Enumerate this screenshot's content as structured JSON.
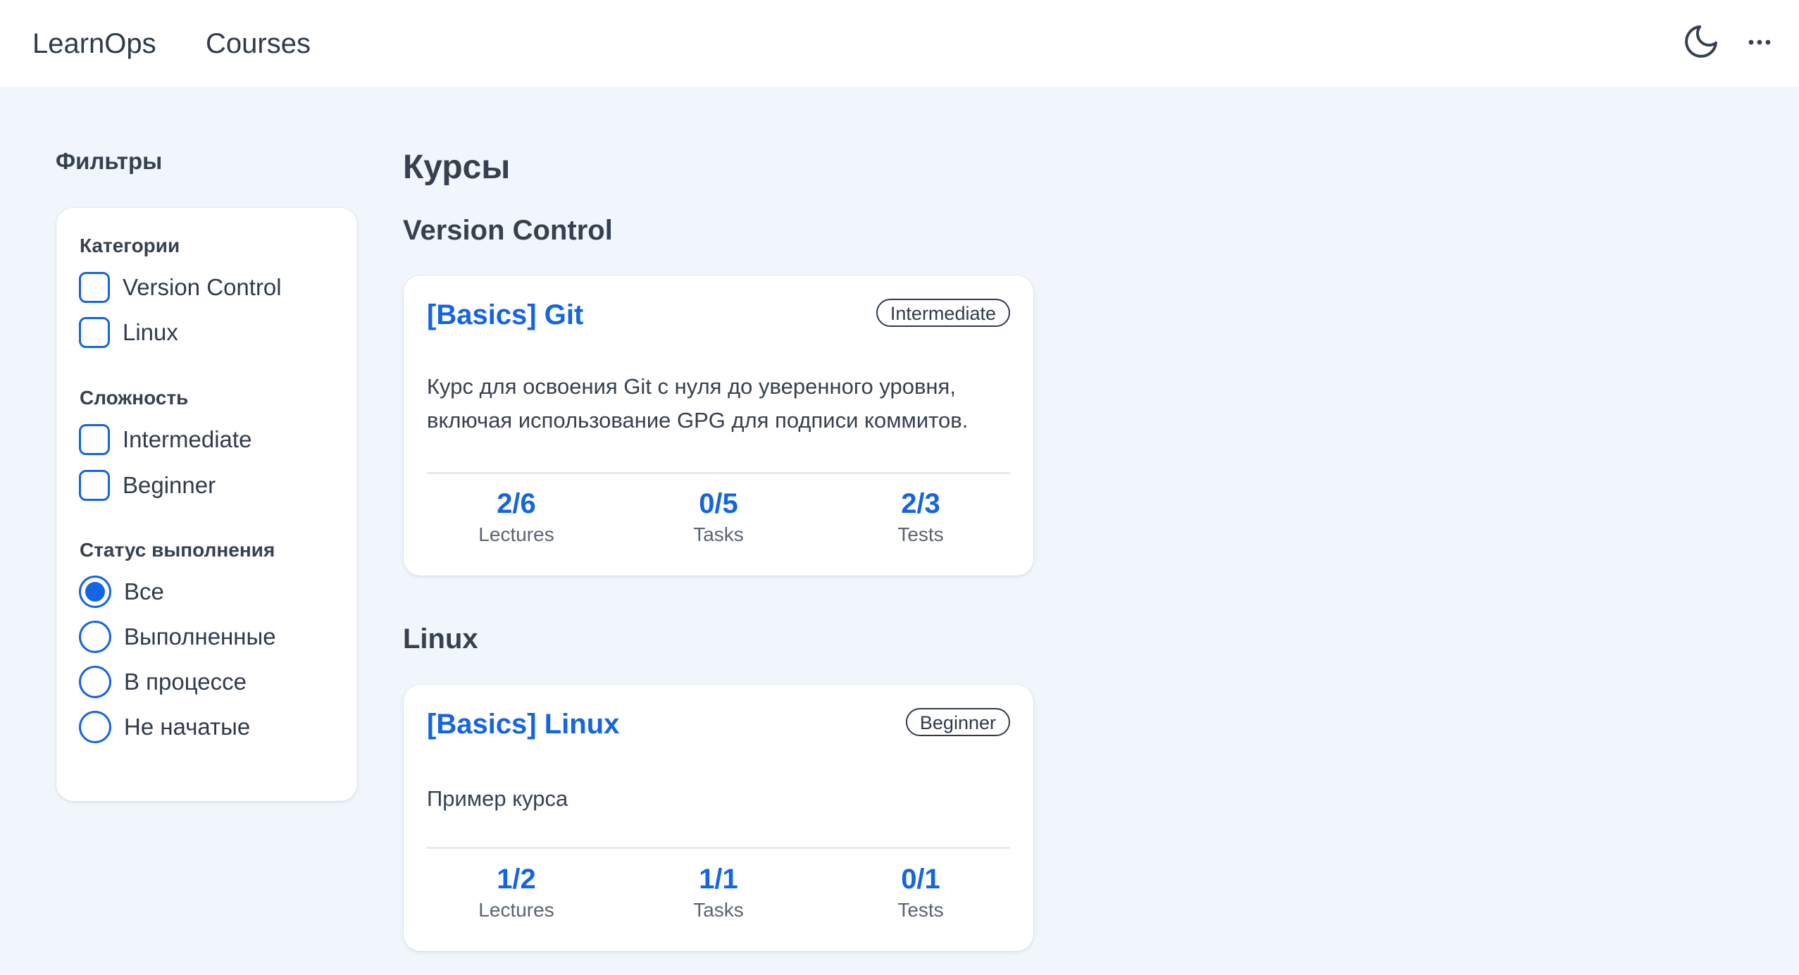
{
  "header": {
    "brand": "LearnOps",
    "nav_courses": "Courses",
    "theme_icon": "moon-icon",
    "more_icon": "more-dots-icon"
  },
  "filters": {
    "title": "Фильтры",
    "categories_label": "Категории",
    "categories": [
      "Version Control",
      "Linux"
    ],
    "difficulty_label": "Сложность",
    "difficulty": [
      "Intermediate",
      "Beginner"
    ],
    "status_label": "Статус выполнения",
    "status": [
      "Все",
      "Выполненные",
      "В процессе",
      "Не начатые"
    ],
    "status_selected": "Все"
  },
  "main": {
    "title": "Курсы",
    "sections": [
      {
        "name": "Version Control",
        "course": {
          "title": "[Basics] Git",
          "level": "Intermediate",
          "description": "Курс для освоения Git с нуля до уверенного уровня, включая использование GPG для подписи коммитов.",
          "stats": [
            {
              "value": "2/6",
              "label": "Lectures"
            },
            {
              "value": "0/5",
              "label": "Tasks"
            },
            {
              "value": "2/3",
              "label": "Tests"
            }
          ]
        }
      },
      {
        "name": "Linux",
        "course": {
          "title": "[Basics] Linux",
          "level": "Beginner",
          "description": "Пример курса",
          "stats": [
            {
              "value": "1/2",
              "label": "Lectures"
            },
            {
              "value": "1/1",
              "label": "Tasks"
            },
            {
              "value": "0/1",
              "label": "Tests"
            }
          ]
        }
      }
    ]
  },
  "colors": {
    "accent": "#1464e6",
    "background": "#f1f5fc",
    "text": "#364150"
  }
}
